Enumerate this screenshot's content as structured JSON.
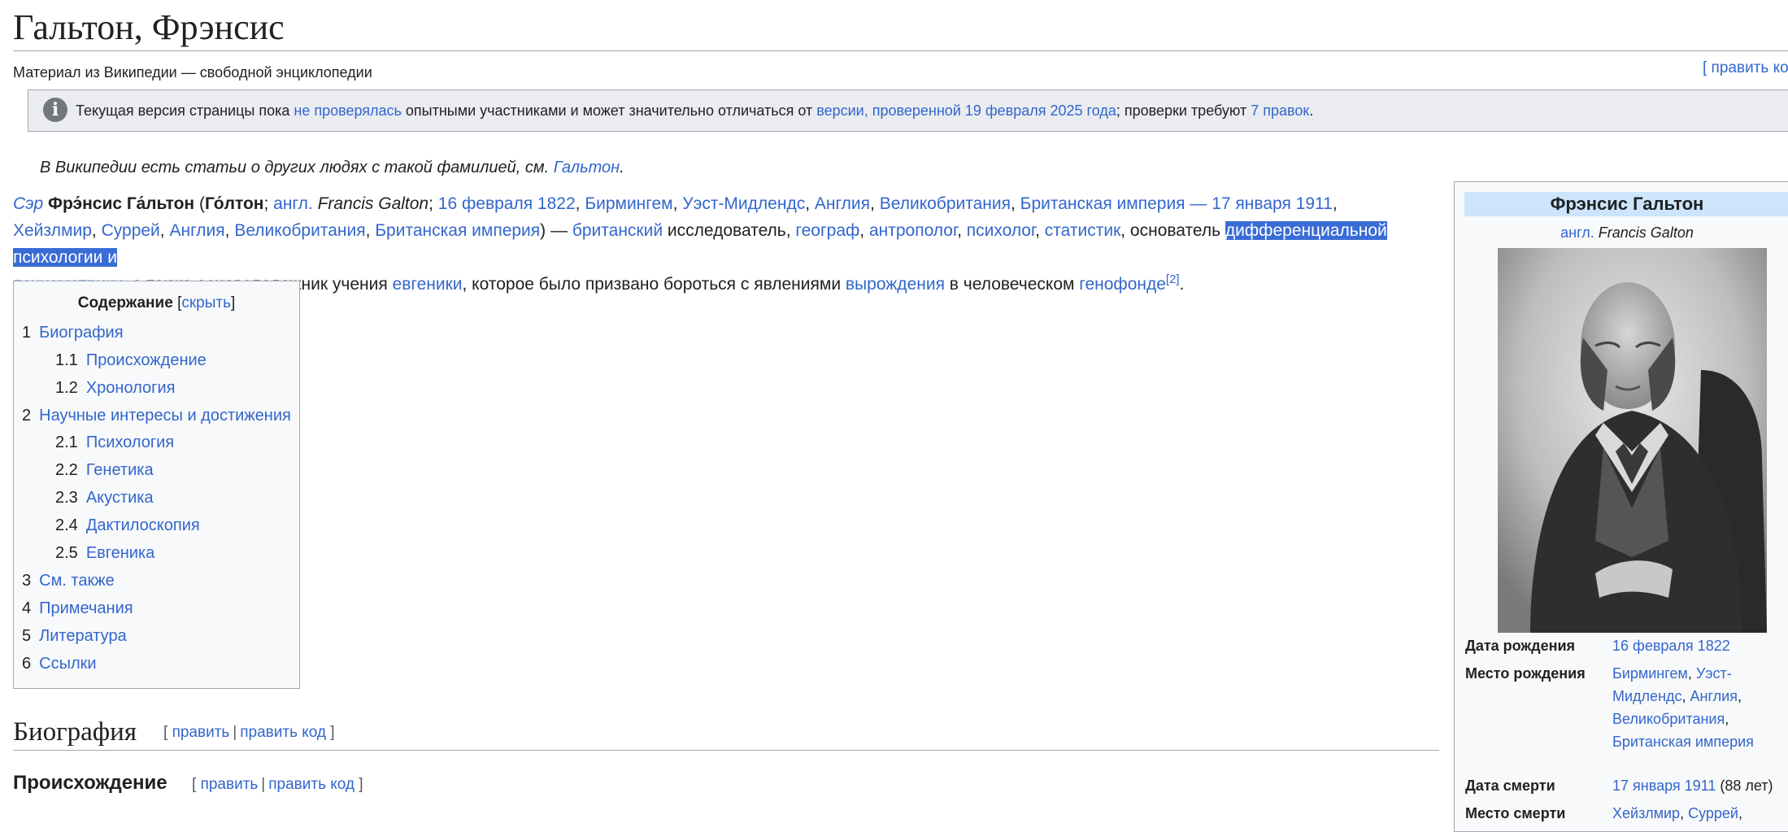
{
  "page": {
    "title": "Гальтон, Фрэнсис",
    "tagline": "Материал из Википедии — свободной энциклопедии",
    "edit_top": "[ править ко"
  },
  "notice": {
    "icon": "info-icon",
    "t1": "Текущая версия страницы пока ",
    "l1": "не проверялась",
    "t2": " опытными участниками и может значительно отличаться от ",
    "l2": "версии, проверенной 19 февраля 2025 года",
    "t3": "; проверки требуют ",
    "l3": "7 правок",
    "t4": "."
  },
  "hatnote": {
    "text": "В Википедии есть статьи о других людях с такой фамилией, см. ",
    "link": "Гальтон",
    "end": "."
  },
  "lead": {
    "sir": "Сэр",
    "name": "Фрэ́нсис Га́льтон",
    "p_open": " (",
    "alt_name": "Го́лтон",
    "semi": "; ",
    "lang": "англ.",
    "orig": "Francis Galton",
    "semi2": "; ",
    "birth_date": "16 февраля 1822",
    "c1": ", ",
    "birth_city": "Бирмингем",
    "c2": ", ",
    "birth_region": "Уэст-Мидлендс",
    "c3": ", ",
    "england": "Англия",
    "c4": ", ",
    "uk": "Великобритания",
    "c5": ", ",
    "empire": "Британская империя",
    "dash": " — ",
    "death_date": "17 января 1911",
    "c6": ", ",
    "death_place": "Хейзлмир",
    "c7": ", ",
    "surrey": "Суррей",
    "c8": ", ",
    "england2": "Англия",
    "c9": ", ",
    "uk2": "Великобритания",
    "c10": ", ",
    "empire2": "Британская империя",
    "p_close": ") — ",
    "british": "британский",
    "t1": " исследователь, ",
    "geographer": "географ",
    "c11": ", ",
    "anthropologist": "антрополог",
    "c12": ", ",
    "psychologist": "психолог",
    "c13": ", ",
    "statistician": "статистик",
    "t2": ", основатель ",
    "diff_psych": "дифференциальной психологии",
    "and": " и",
    "psychometrics": "психометрики",
    "t3": ", а также основоположник учения ",
    "eugenics": "евгеники",
    "t4": ", которое было призвано бороться с явлениями ",
    "degeneration": "вырождения",
    "t5": " в человеческом ",
    "genepool": "генофонде",
    "ref": "[2]",
    "end": "."
  },
  "toc": {
    "heading": "Содержание",
    "toggle_open": "[",
    "toggle": "скрыть",
    "toggle_close": "]",
    "items": [
      {
        "num": "1",
        "label": "Биография"
      },
      {
        "num": "1.1",
        "label": "Происхождение"
      },
      {
        "num": "1.2",
        "label": "Хронология"
      },
      {
        "num": "2",
        "label": "Научные интересы и достижения"
      },
      {
        "num": "2.1",
        "label": "Психология"
      },
      {
        "num": "2.2",
        "label": "Генетика"
      },
      {
        "num": "2.3",
        "label": "Акустика"
      },
      {
        "num": "2.4",
        "label": "Дактилоскопия"
      },
      {
        "num": "2.5",
        "label": "Евгеника"
      },
      {
        "num": "3",
        "label": "См. также"
      },
      {
        "num": "4",
        "label": "Примечания"
      },
      {
        "num": "5",
        "label": "Литература"
      },
      {
        "num": "6",
        "label": "Ссылки"
      }
    ]
  },
  "sections": {
    "h2": "Биография",
    "h3": "Происхождение",
    "edit_open": "[ ",
    "edit": "править",
    "sep": "|",
    "edit_code": "править код",
    "edit_close": " ]"
  },
  "infobox": {
    "title": "Фрэнсис Гальтон",
    "lang": "англ.",
    "orig": "Francis Galton",
    "birth_date_label": "Дата рождения",
    "birth_date": "16 февраля 1822",
    "birth_place_label": "Место рождения",
    "bp1": "Бирмингем",
    "bp_c1": ", ",
    "bp2": "Уэст-Мидлендс",
    "bp_c2": ", ",
    "bp3": "Англия",
    "bp_c3": ",",
    "bp4": "Великобритания",
    "bp_c4": ",",
    "bp5": "Британская империя",
    "death_date_label": "Дата смерти",
    "death_date": "17 января 1911",
    "age": " (88 лет)",
    "death_place_label": "Место смерти",
    "dp1": "Хейзлмир",
    "dp_c1": ", ",
    "dp2": "Суррей",
    "dp_c2": ","
  }
}
